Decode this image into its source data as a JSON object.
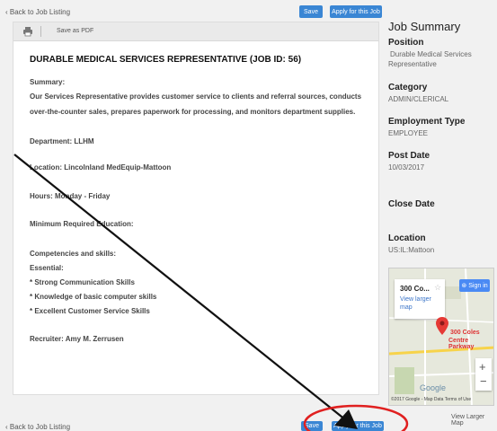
{
  "nav": {
    "back_top": "‹ Back to Job Listing",
    "back_bottom": "‹ Back to Job Listing",
    "save_label": "Save",
    "apply_label": "Apply for this Job"
  },
  "toolbar": {
    "save_pdf": "Save as PDF"
  },
  "job": {
    "title": "DURABLE MEDICAL SERVICES REPRESENTATIVE (JOB ID: 56)",
    "summary_heading": "Summary:",
    "summary_line1": "Our Services Representative provides customer service to clients and referral sources, conducts",
    "summary_line2": "over-the-counter sales, prepares paperwork for processing, and monitors department supplies.",
    "department": "Department: LLHM",
    "location": "Location: Lincolnland MedEquip-Mattoon",
    "hours": "Hours: Monday - Friday",
    "education": "Minimum Required Education:",
    "competencies": "Competencies and skills:",
    "essential": "Essential:",
    "skills": [
      "* Strong Communication Skills",
      "* Knowledge of basic computer skills",
      "* Excellent Customer Service Skills"
    ],
    "recruiter": "Recruiter:  Amy M. Zerrusen"
  },
  "summary": {
    "heading": "Job Summary",
    "position_label": "Position",
    "position_value_1": "Durable Medical Services",
    "position_value_2": "Representative",
    "category_label": "Category",
    "category_value": "ADMIN/CLERICAL",
    "emp_type_label": "Employment Type",
    "emp_type_value": "EMPLOYEE",
    "post_date_label": "Post Date",
    "post_date_value": "10/03/2017",
    "close_date_label": "Close Date",
    "location_label": "Location",
    "location_value": "US:IL:Mattoon"
  },
  "map": {
    "place": "300 Co...",
    "view_larger": "View larger map",
    "sign_in": "Sign in",
    "pin_label_1": "300 Coles",
    "pin_label_2": "Centre Parkway",
    "google": "Google",
    "attribution": "©2017 Google - Map Data   Terms of Use",
    "view_larger_map": "View Larger Map"
  },
  "colors": {
    "button": "#3a86d4",
    "annotation_circle": "#e02020",
    "pin": "#e53935"
  }
}
